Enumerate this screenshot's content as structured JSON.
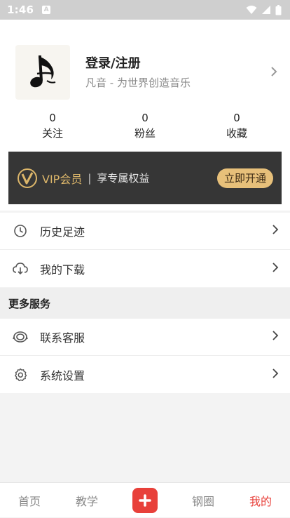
{
  "status_bar": {
    "time": "1:46",
    "notification_letter": "A"
  },
  "profile": {
    "login_label": "登录/注册",
    "slogan": "凡音 - 为世界创造音乐",
    "stats": [
      {
        "value": "0",
        "label": "关注"
      },
      {
        "value": "0",
        "label": "粉丝"
      },
      {
        "value": "0",
        "label": "收藏"
      }
    ]
  },
  "vip": {
    "title": "VIP会员",
    "separator": "|",
    "subtitle": "享专属权益",
    "button_label": "立即开通"
  },
  "menu": {
    "history_label": "历史足迹",
    "downloads_label": "我的下载"
  },
  "more_services": {
    "header": "更多服务",
    "support_label": "联系客服",
    "settings_label": "系统设置"
  },
  "bottom_nav": {
    "home": "首页",
    "teaching": "教学",
    "circle": "钢圈",
    "mine": "我的"
  },
  "colors": {
    "accent": "#e8403a",
    "vip_gold": "#dcb66a",
    "vip_bg": "#363636"
  },
  "icons": {
    "history": "clock-icon",
    "downloads": "cloud-download-icon",
    "support": "headset-icon",
    "settings": "gear-icon",
    "add": "plus-icon"
  }
}
